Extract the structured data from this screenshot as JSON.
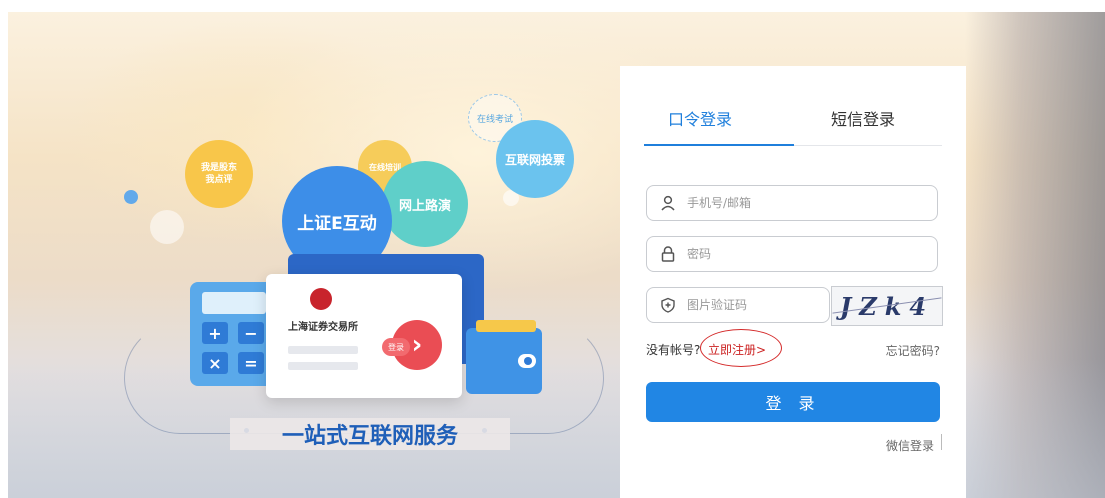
{
  "promo": {
    "bubble_shareholder": "我是股东\n我点评",
    "bubble_training": "在线培训",
    "bubble_e_interact": "上证E互动",
    "bubble_roadshow": "网上路演",
    "bubble_vote": "互联网投票",
    "bubble_exam": "在线考试",
    "card_logo_text": "上海证券交易所",
    "card_pill": "登录",
    "tagline": "一站式互联网服务"
  },
  "login": {
    "tabs": [
      {
        "label": "口令登录",
        "active": true
      },
      {
        "label": "短信登录",
        "active": false
      }
    ],
    "phone_placeholder": "手机号/邮箱",
    "password_placeholder": "密码",
    "captcha_placeholder": "图片验证码",
    "captcha_text": "JZk4",
    "no_account": "没有帐号?",
    "register_link": "立即注册>",
    "forgot": "忘记密码?",
    "submit": "登 录",
    "wechat_login": "微信登录"
  },
  "colors": {
    "accent": "#2186e4",
    "register_red": "#d42a2a"
  }
}
